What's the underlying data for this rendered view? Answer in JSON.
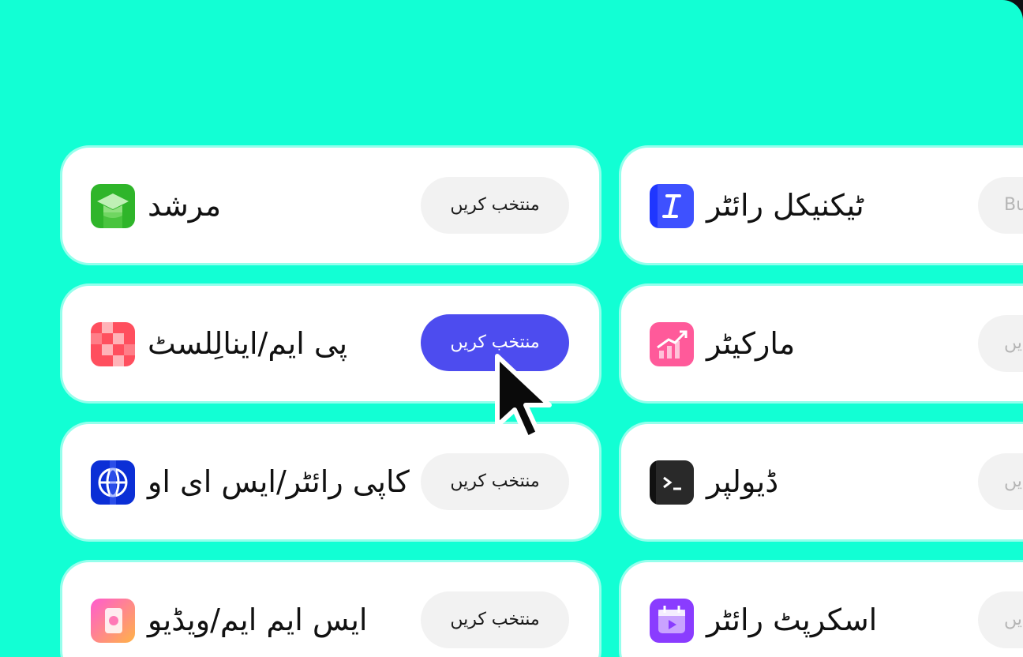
{
  "colors": {
    "background": "#12ffd4",
    "card": "#ffffff",
    "button_default": "#f2f2f2",
    "button_active": "#4d4cef"
  },
  "left_column": [
    {
      "name": "مرشد",
      "button": "منتخب کریں",
      "icon": "graduation-cap-icon",
      "active": false
    },
    {
      "name": "پی ایم/اینالِلسٹ",
      "button": "منتخب کریں",
      "icon": "pixel-pattern-icon",
      "active": true
    },
    {
      "name": "کاپی رائٹر/ایس ای او",
      "button": "منتخب کریں",
      "icon": "globe-icon",
      "active": false
    },
    {
      "name": "ایس ایم ایم/ویڈیو",
      "button": "منتخب کریں",
      "icon": "social-video-icon",
      "active": false
    }
  ],
  "right_column": [
    {
      "name": "ٹیکنیکل رائٹر",
      "button_peek": "Bu",
      "icon": "italic-text-icon"
    },
    {
      "name": "مارکیٹر",
      "button_peek": "یں",
      "icon": "growth-chart-icon"
    },
    {
      "name": "ڈیولپر",
      "button_peek": "یں",
      "icon": "terminal-icon"
    },
    {
      "name": "اسکرپٹ رائٹر",
      "button_peek": "یں",
      "icon": "calendar-play-icon"
    }
  ]
}
